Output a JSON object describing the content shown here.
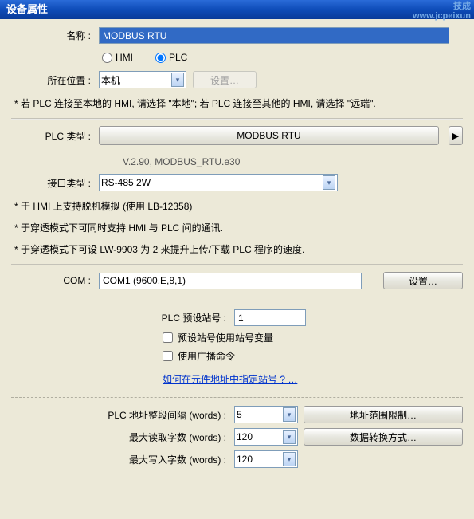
{
  "title": "设备属性",
  "watermark": {
    "l1": "技成",
    "l2": "www.jcpeixun"
  },
  "name": {
    "label": "名称 :",
    "value": "MODBUS RTU"
  },
  "device_type": {
    "hmi": "HMI",
    "plc": "PLC"
  },
  "location": {
    "label": "所在位置 :",
    "value": "本机",
    "settings_btn": "设置…"
  },
  "note1": "* 若 PLC 连接至本地的 HMI, 请选择 \"本地\"; 若 PLC 连接至其他的 HMI, 请选择 \"远端\".",
  "plc_type": {
    "label": "PLC 类型 :",
    "value": "MODBUS RTU",
    "version": "V.2.90, MODBUS_RTU.e30"
  },
  "iface": {
    "label": "接口类型 :",
    "value": "RS-485 2W"
  },
  "note2": "* 于 HMI 上支持脱机模拟 (使用 LB-12358)",
  "note3": "* 于穿透模式下可同时支持 HMI 与 PLC 间的通讯.",
  "note4": "* 于穿透模式下可设 LW-9903 为 2 来提升上传/下载 PLC 程序的速度.",
  "com": {
    "label": "COM :",
    "value": "COM1 (9600,E,8,1)",
    "settings_btn": "设置…"
  },
  "station": {
    "label": "PLC 预设站号 :",
    "value": "1",
    "cb_variable": "预设站号使用站号变量",
    "cb_broadcast": "使用广播命令",
    "link": "如何在元件地址中指定站号 ? …"
  },
  "addr": {
    "interval_label": "PLC 地址整段间隔 (words) :",
    "interval_value": "5",
    "read_label": "最大读取字数 (words) :",
    "read_value": "120",
    "write_label": "最大写入字数 (words) :",
    "write_value": "120",
    "range_btn": "地址范围限制…",
    "convert_btn": "数据转换方式…"
  }
}
